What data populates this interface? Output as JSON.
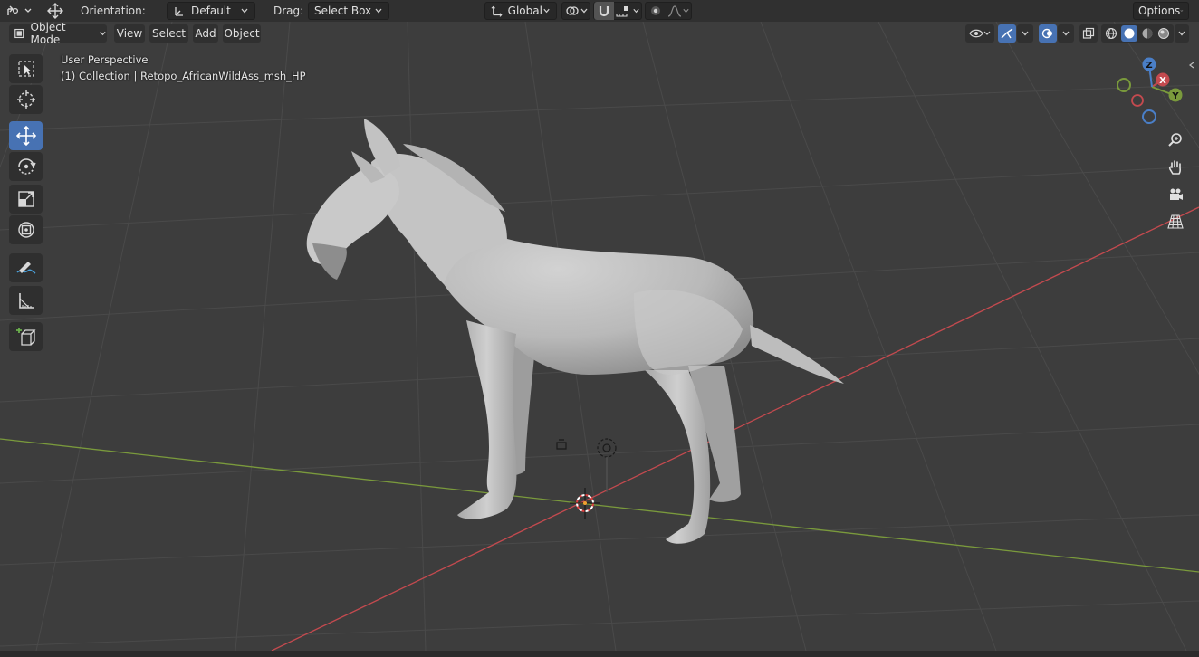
{
  "tool_settings": {
    "orientation_label": "Orientation:",
    "orientation_value": "Default",
    "drag_label": "Drag:",
    "drag_value": "Select Box",
    "transform_orientation": "Global",
    "options_label": "Options"
  },
  "header": {
    "mode": "Object Mode",
    "menus": [
      "View",
      "Select",
      "Add",
      "Object"
    ]
  },
  "overlay": {
    "view_name": "User Perspective",
    "collection_info": "(1) Collection | Retopo_AfricanWildAss_msh_HP"
  },
  "gizmo": {
    "axes": [
      "X",
      "Y",
      "Z"
    ]
  },
  "toolbar": {
    "tools": [
      "select-box",
      "cursor",
      "move",
      "rotate",
      "scale",
      "transform",
      "annotate",
      "measure",
      "add-cube"
    ],
    "active_tool": "move"
  },
  "nav_buttons": [
    "zoom",
    "pan",
    "camera",
    "ortho-toggle"
  ],
  "colors": {
    "active_blue": "#4772b3",
    "x_axis": "#c44a4f",
    "y_axis": "#7a9a3c",
    "z_axis": "#4a7fc8",
    "bar": "#303030",
    "viewport": "#3d3d3d"
  }
}
